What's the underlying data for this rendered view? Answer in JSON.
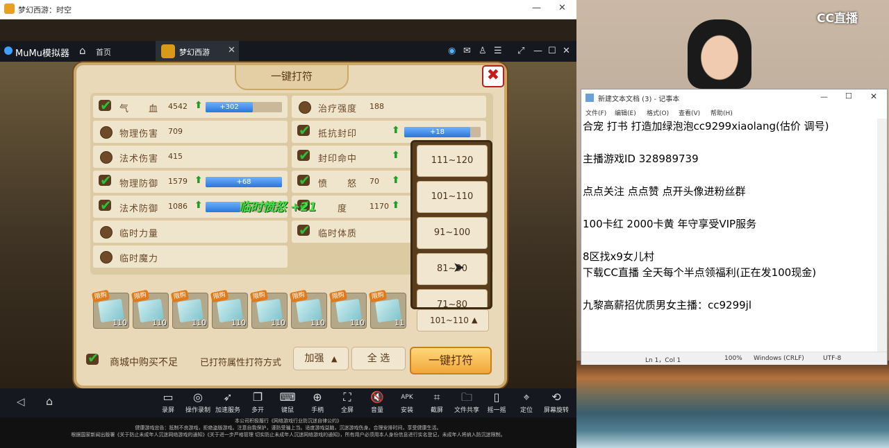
{
  "window_title": "梦幻西游：时空",
  "emulator": {
    "brand": "MuMu模拟器",
    "home_tab": "首页",
    "game_tab": "梦幻西游"
  },
  "dialog": {
    "title": "一键打符",
    "close_glyph": "✖",
    "left_attrs": [
      {
        "name": "气　　血",
        "checked": true,
        "value": "4542",
        "bar": "+302"
      },
      {
        "name": "物理伤害",
        "checked": false,
        "value": "709"
      },
      {
        "name": "法术伤害",
        "checked": false,
        "value": "415"
      },
      {
        "name": "物理防御",
        "checked": true,
        "value": "1579",
        "bar": "+68"
      },
      {
        "name": "法术防御",
        "checked": true,
        "value": "1086",
        "bar": ""
      },
      {
        "name": "临时力量",
        "checked": false,
        "value": ""
      },
      {
        "name": "临时魔力",
        "checked": false,
        "value": ""
      }
    ],
    "right_attrs": [
      {
        "name": "治疗强度",
        "checked": false,
        "value": "188"
      },
      {
        "name": "抵抗封印",
        "checked": true,
        "value": "",
        "bar": "+18"
      },
      {
        "name": "封印命中",
        "checked": true,
        "value": ""
      },
      {
        "name": "愤　　怒",
        "checked": true,
        "value": "70"
      },
      {
        "name": "　　度",
        "checked": true,
        "value": "1170"
      },
      {
        "name": "临时体质",
        "checked": true,
        "value": ""
      }
    ],
    "float_text": "临时愤怒 +21",
    "level_options": [
      "111~120",
      "101~110",
      "91~100",
      "81~90",
      "71~80"
    ],
    "items": [
      {
        "tag": "限购",
        "level": "110"
      },
      {
        "tag": "限购",
        "level": "110"
      },
      {
        "tag": "限购",
        "level": "110"
      },
      {
        "tag": "限购",
        "level": "110"
      },
      {
        "tag": "限购",
        "level": "110"
      },
      {
        "tag": "限购",
        "level": "110"
      },
      {
        "tag": "限购",
        "level": "110"
      },
      {
        "tag": "限购",
        "level": "11"
      }
    ],
    "level_selected": "101~110",
    "mall_label": "商城中购买不足",
    "attr_method_label": "已打符属性打符方式",
    "method_value": "加强",
    "select_all": "全 选",
    "onekey_button": "一键打符"
  },
  "toolbar": [
    {
      "label": "录屏",
      "icon": "record-icon",
      "glyph": "▭"
    },
    {
      "label": "操作录制",
      "icon": "macro-icon",
      "glyph": "◎"
    },
    {
      "label": "加速服务",
      "icon": "rocket-icon",
      "glyph": "➶"
    },
    {
      "label": "多开",
      "icon": "multi-icon",
      "glyph": "❐"
    },
    {
      "label": "键鼠",
      "icon": "keyboard-icon",
      "glyph": "⌨"
    },
    {
      "label": "手柄",
      "icon": "gamepad-icon",
      "glyph": "⊕"
    },
    {
      "label": "全屏",
      "icon": "fullscreen-icon",
      "glyph": "⛶"
    },
    {
      "label": "音量",
      "icon": "volume-icon",
      "glyph": "🔇"
    },
    {
      "label": "安装",
      "icon": "apk-icon",
      "glyph": "APK"
    },
    {
      "label": "截屏",
      "icon": "crop-icon",
      "glyph": "⌗"
    },
    {
      "label": "文件共享",
      "icon": "folder-icon",
      "glyph": "🗀"
    },
    {
      "label": "摇一摇",
      "icon": "shake-icon",
      "glyph": "▯"
    },
    {
      "label": "定位",
      "icon": "location-icon",
      "glyph": "⌖"
    },
    {
      "label": "屏幕旋转",
      "icon": "rotate-icon",
      "glyph": "⟲"
    }
  ],
  "footer_lines": [
    "本公司积极履行《网络游戏行业防沉迷自律公约》",
    "健康游戏忠告：抵制不良游戏，拒绝盗版游戏。注意自我保护，谨防受骗上当。适度游戏益脑，沉迷游戏伤身。合理安排时间，享受健康生活。",
    "根据国家新闻出版署《关于防止未成年人沉迷网络游戏的通知》《关于进一步严格管理 切实防止未成年人沉迷网络游戏的通知》，所有用户必须用本人身份信息进行实名登记，未成年人将纳入防沉迷限制。"
  ],
  "stream": {
    "logo": "CC直播"
  },
  "notepad": {
    "title": "新建文本文档 (3) - 记事本",
    "menu": [
      "文件(F)",
      "编辑(E)",
      "格式(O)",
      "查看(V)",
      "帮助(H)"
    ],
    "lines": [
      "合宠 打书 打造加绿泡泡cc9299xiaolang(估价 调号)",
      "",
      "主播游戏ID 328989739",
      "",
      "点点关注  点点赞   点开头像进粉丝群",
      "",
      "100卡红  2000卡黄 年守享受VIP服务",
      "",
      "8区找x9女儿村",
      "下载CC直播 全天每个半点领福利(正在发100现金)",
      "",
      "九黎高薪招优质男女主播：cc9299jl"
    ],
    "status": {
      "pos": "Ln 1，Col 1",
      "zoom": "100%",
      "eol": "Windows (CRLF)",
      "enc": "UTF-8"
    }
  }
}
